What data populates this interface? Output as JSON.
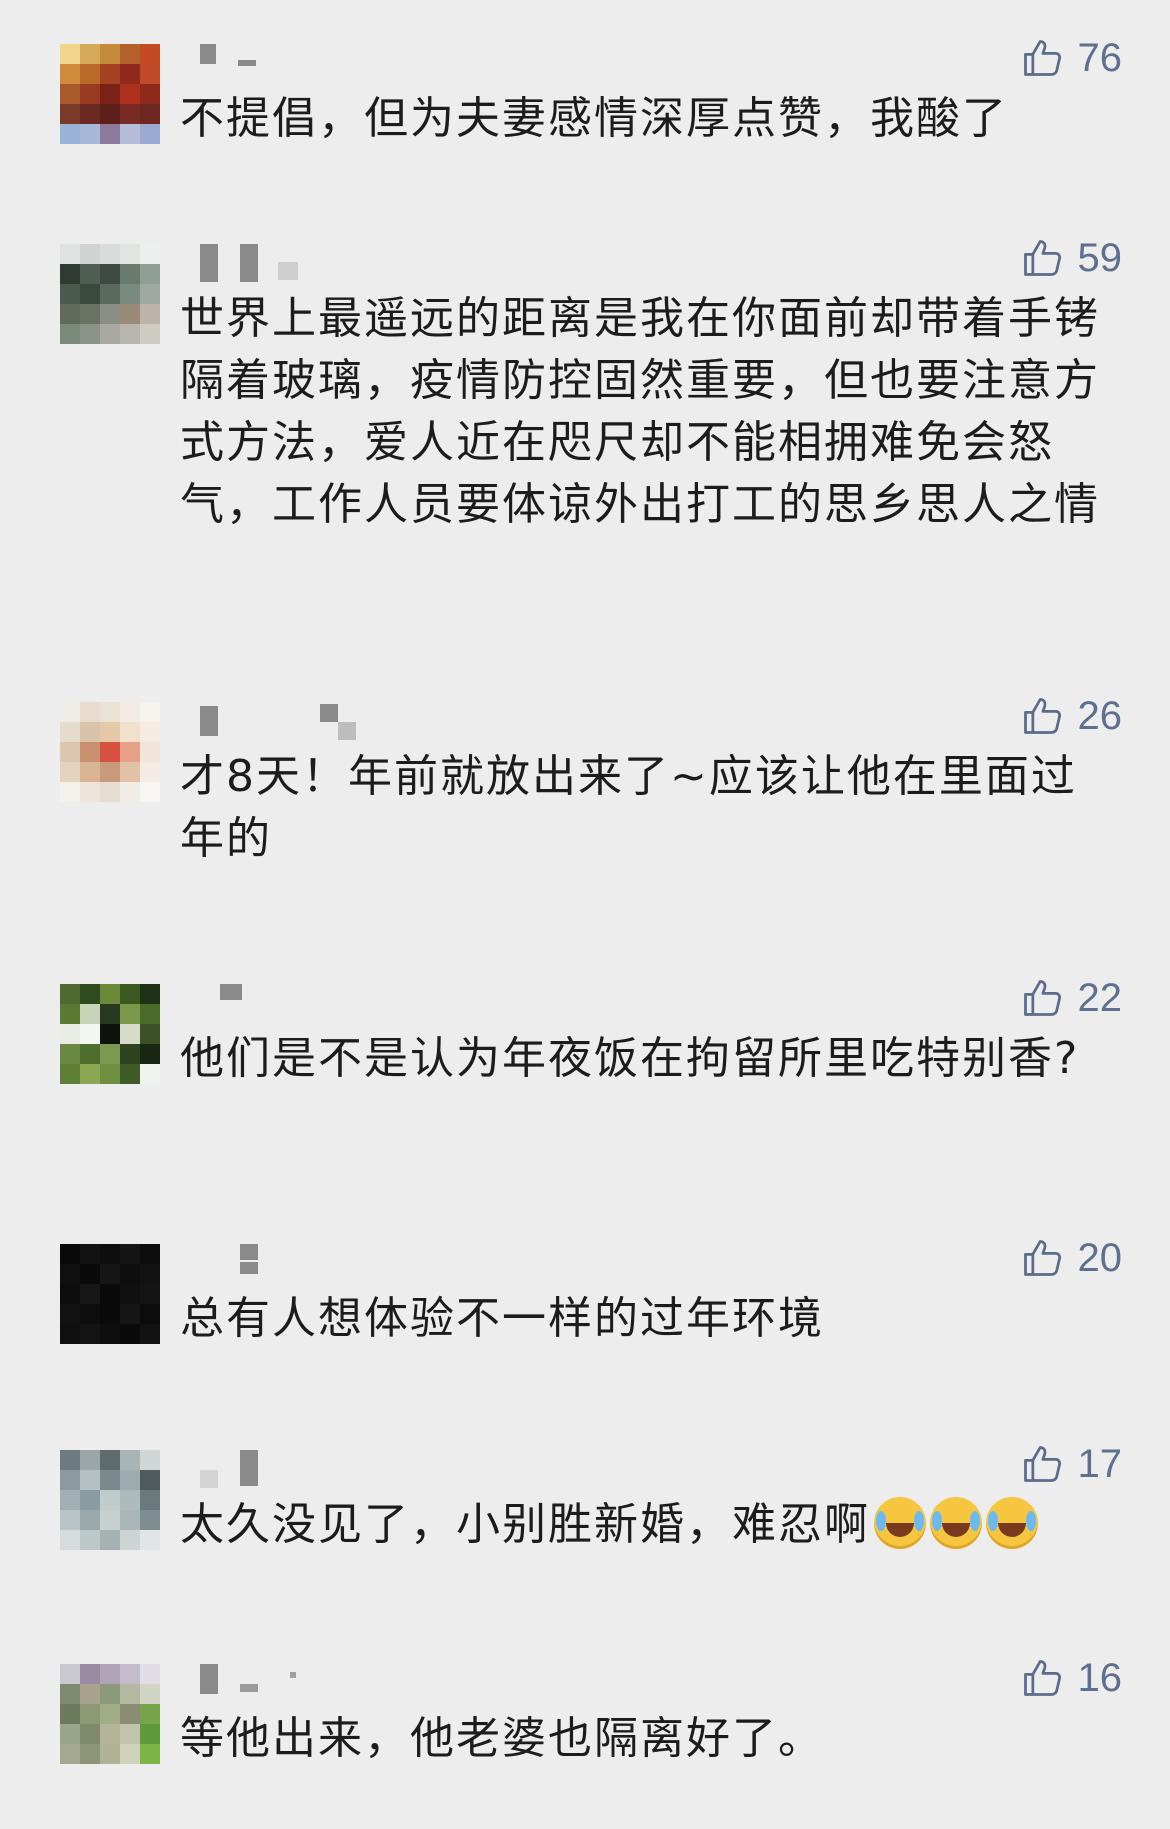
{
  "comments": [
    {
      "likes": "76",
      "text": "不提倡，但为夫妻感情深厚点赞，我酸了",
      "avatar_colors": [
        "#f0d58a",
        "#d6a85a",
        "#c58a3a",
        "#b4602a",
        "#c44a26",
        "#d08a3a",
        "#b96a2a",
        "#a44222",
        "#8f2a1c",
        "#c04a2a",
        "#a85a2a",
        "#9a3a22",
        "#7a2218",
        "#b0301e",
        "#8e2a1c",
        "#7a3a2a",
        "#6a2a22",
        "#5e1e1a",
        "#7a2a24",
        "#6e2620",
        "#9ab4d8",
        "#a8b8d8",
        "#8e7a9c",
        "#b4bcd8",
        "#9aaad0"
      ]
    },
    {
      "likes": "59",
      "text": "世界上最遥远的距离是我在你面前却带着手铐隔着玻璃，疫情防控固然重要，但也要注意方式方法，爱人近在咫尺却不能相拥难免会怒气，工作人员要体谅外出打工的思乡思人之情",
      "avatar_colors": [
        "#dfe2e0",
        "#cfd4d2",
        "#d8dcda",
        "#e2e4e2",
        "#ecefed",
        "#2e3a32",
        "#4e5e52",
        "#3e4a42",
        "#6a7a6e",
        "#8e9e92",
        "#4a5a4c",
        "#3a4a3e",
        "#5a6a5c",
        "#7a8a7e",
        "#a0a8a2",
        "#5e6a5a",
        "#6a7262",
        "#8a8e84",
        "#9a8a7a",
        "#bcb4aa",
        "#7a8a7a",
        "#8a9488",
        "#a8aaa2",
        "#b8b6ae",
        "#d0ccc4"
      ]
    },
    {
      "likes": "26",
      "text": "才8天！年前就放出来了~应该让他在里面过年的",
      "avatar_colors": [
        "#f0ece6",
        "#e8dccf",
        "#ebe2d6",
        "#f2ece4",
        "#f6f2ee",
        "#e6dccc",
        "#d8c2a8",
        "#e4c8a8",
        "#f0e0cc",
        "#f4ece2",
        "#dcc6ae",
        "#c89070",
        "#d85040",
        "#e6a088",
        "#f2e4d8",
        "#e2d2be",
        "#d8b492",
        "#c89a7a",
        "#e2c2a6",
        "#f4ece4",
        "#f4f0ea",
        "#ece4da",
        "#e6dcd0",
        "#f2ece6",
        "#f8f6f2"
      ]
    },
    {
      "likes": "22",
      "text": "他们是不是认为年夜饭在拘留所里吃特别香?",
      "avatar_colors": [
        "#4e6a2e",
        "#2e4a1e",
        "#6a8a3a",
        "#3a5a22",
        "#1e3016",
        "#5a7a34",
        "#c8d4b8",
        "#2a3a20",
        "#7a9a4a",
        "#4a6a2a",
        "#e8ece4",
        "#f4f6f2",
        "#0e140c",
        "#d4dcc8",
        "#3a5226",
        "#6a8a42",
        "#4e6e2e",
        "#7a9a52",
        "#2e4420",
        "#1a2614",
        "#5e7e36",
        "#8aa852",
        "#6e8e42",
        "#3e5a26",
        "#f0f2ee"
      ]
    },
    {
      "likes": "20",
      "text": "总有人想体验不一样的过年环境",
      "avatar_colors": [
        "#0a0a0a",
        "#121212",
        "#0e0e0e",
        "#141414",
        "#0c0c0c",
        "#101010",
        "#0a0a0a",
        "#161616",
        "#0e0e0e",
        "#121212",
        "#0c0c0c",
        "#181818",
        "#0a0a0a",
        "#101010",
        "#141414",
        "#121212",
        "#0e0e0e",
        "#0a0a0a",
        "#161616",
        "#0c0c0c",
        "#101010",
        "#141414",
        "#0e0e0e",
        "#0a0a0a",
        "#121212"
      ]
    },
    {
      "likes": "17",
      "text": "太久没见了，小别胜新婚，难忍啊",
      "emoji_count": 3,
      "avatar_colors": [
        "#6e7a82",
        "#9aa6aa",
        "#5e6a6c",
        "#a8b4b6",
        "#ced6d6",
        "#8a9aa0",
        "#b4c0c2",
        "#7a8a8c",
        "#9eacb0",
        "#4e5a5c",
        "#a0b0b4",
        "#8a9ca2",
        "#c0cccc",
        "#aebabc",
        "#6a7a7c",
        "#b8c4c6",
        "#9aa8aa",
        "#c6d0d0",
        "#aab6b8",
        "#7e8e90",
        "#d4dcdc",
        "#bcc8ca",
        "#a4b2b4",
        "#ccd4d4",
        "#e0e6e6"
      ]
    },
    {
      "likes": "16",
      "text": "等他出来，他老婆也隔离好了。",
      "avatar_colors": [
        "#c8c8ce",
        "#9a8aa2",
        "#b0a4b6",
        "#c4bccc",
        "#e0dde4",
        "#7e8a6e",
        "#a8a28e",
        "#8a9a7a",
        "#b4b8a0",
        "#d0d4c4",
        "#6a7a5a",
        "#8e9a76",
        "#a0ac86",
        "#8a8c74",
        "#78a44a",
        "#9aa48a",
        "#7e8a6a",
        "#b4b49a",
        "#c0c4ac",
        "#5e9a3a",
        "#a4a88e",
        "#8e9478",
        "#b0b296",
        "#d0d2bc",
        "#7cb448"
      ]
    }
  ]
}
